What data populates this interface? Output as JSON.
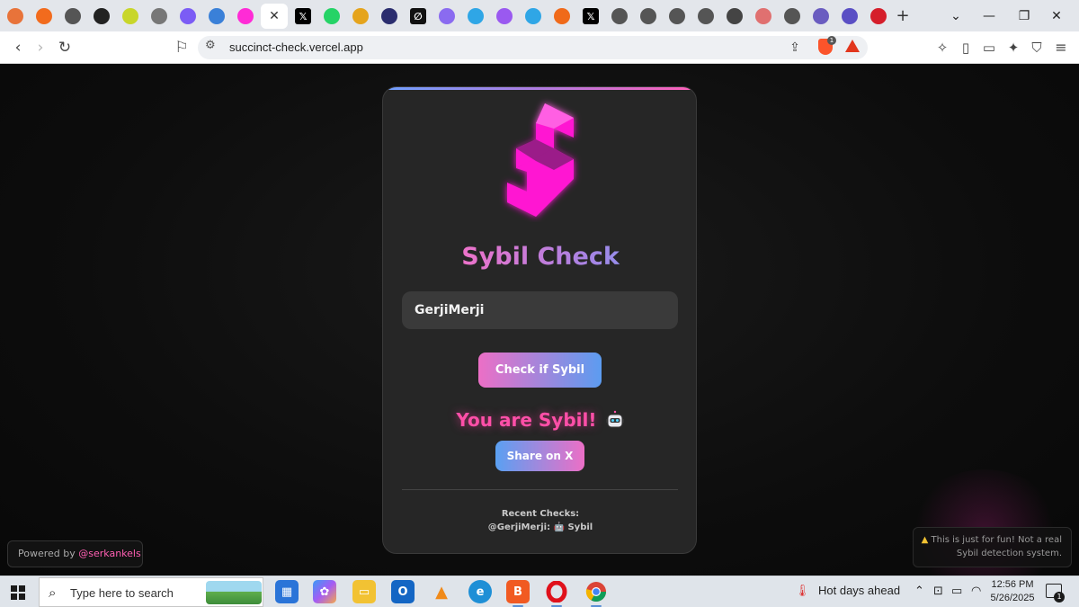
{
  "browser": {
    "tabs": [
      {
        "icon": "orange-circle-icon",
        "color": "#e8733a"
      },
      {
        "icon": "orange-circle-icon",
        "color": "#f26b1d"
      },
      {
        "icon": "gear-ring-icon",
        "color": "#555555"
      },
      {
        "icon": "x-ring-icon",
        "color": "#222222"
      },
      {
        "icon": "face-icon",
        "color": "#c8d62a"
      },
      {
        "icon": "ring-icon",
        "color": "#777777"
      },
      {
        "icon": "diamond-icon",
        "color": "#7b5cf5"
      },
      {
        "icon": "w-icon",
        "color": "#3a80d8"
      },
      {
        "icon": "s-icon",
        "color": "#ff2bd6"
      },
      {
        "icon": "close-icon",
        "color": "#ffffff",
        "active": true
      },
      {
        "icon": "x-logo-icon",
        "color": "#000000"
      },
      {
        "icon": "whatsapp-icon",
        "color": "#25d366"
      },
      {
        "icon": "chrome-like-icon",
        "color": "#e5a41d"
      },
      {
        "icon": "ring-icon",
        "color": "#2b2d6e"
      },
      {
        "icon": "slash-icon",
        "color": "#111111"
      },
      {
        "icon": "ring-icon",
        "color": "#8a6bf0"
      },
      {
        "icon": "l-icon",
        "color": "#2fa6e6"
      },
      {
        "icon": "flower-icon",
        "color": "#9a59f0"
      },
      {
        "icon": "l-icon",
        "color": "#2fa6e6"
      },
      {
        "icon": "chain-icon",
        "color": "#f06a1a"
      },
      {
        "icon": "x-logo-icon",
        "color": "#000000"
      },
      {
        "icon": "ring-icon",
        "color": "#555555"
      },
      {
        "icon": "ring-icon",
        "color": "#555555"
      },
      {
        "icon": "ring-icon",
        "color": "#555555"
      },
      {
        "icon": "ring-icon",
        "color": "#555555"
      },
      {
        "icon": "gear-ring-icon",
        "color": "#444444"
      },
      {
        "icon": "shield-icon",
        "color": "#e07070"
      },
      {
        "icon": "ring-icon",
        "color": "#555555"
      },
      {
        "icon": "ring-icon",
        "color": "#6a5cc0"
      },
      {
        "icon": "ring-icon",
        "color": "#5a4fc4"
      },
      {
        "icon": "d-icon",
        "color": "#d51e2b"
      }
    ],
    "url": "succinct-check.vercel.app",
    "brave_badge": "1"
  },
  "page": {
    "title": "Sybil Check",
    "username_value": "GerjiMerji",
    "check_button": "Check if Sybil",
    "result_text": "You are Sybil!",
    "result_emoji": "robot-icon",
    "share_button": "Share on X",
    "recent_title": "Recent Checks:",
    "recent_item": "@GerjiMerji: 🤖 Sybil",
    "powered_prefix": "Powered by ",
    "powered_handle": "@serkankels",
    "disclaimer": "This is just for fun! Not a real Sybil detection system.",
    "colors": {
      "accent_pink": "#ff2bd6",
      "title_gradient_start": "#ff6ec4",
      "title_gradient_end": "#6ea8ff",
      "result_pink": "#ff4fa8"
    }
  },
  "taskbar": {
    "search_placeholder": "Type here to search",
    "weather": "Hot days ahead",
    "time": "12:56 PM",
    "date": "5/26/2025",
    "notification_count": "1"
  }
}
